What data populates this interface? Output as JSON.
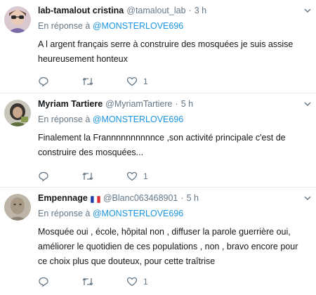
{
  "tweets": [
    {
      "name": "lab-tamalout cristina",
      "flag": false,
      "handle": "@tamalout_lab",
      "separator": "·",
      "time": "3 h",
      "reply_prefix": "En réponse à",
      "reply_mention": "@MONSTERLOVE696",
      "text": "A l argent français serre à construire des mosquées je suis assise heureusement honteux",
      "likes": "1"
    },
    {
      "name": "Myriam Tartiere",
      "flag": false,
      "handle": "@MyriamTartiere",
      "separator": "·",
      "time": "5 h",
      "reply_prefix": "En réponse à",
      "reply_mention": "@MONSTERLOVE696",
      "text": "Finalement la Frannnnnnnnnnce ,son activité principale c'est de construire des mosquées...",
      "likes": "1"
    },
    {
      "name": "Empennage",
      "flag": true,
      "handle": "@Blanc063468901",
      "separator": "·",
      "time": "5 h",
      "reply_prefix": "En réponse à",
      "reply_mention": "@MONSTERLOVE696",
      "text": "Mosquée oui , école, hôpital non , diffuser la parole guerrière oui, améliorer le quotidien de ces populations , non , bravo encore pour ce choix plus que douteux, pour cette traîtrise",
      "likes": "1"
    }
  ],
  "colors": {
    "name": "#14171a",
    "muted": "#657786",
    "mention": "#1b95e0",
    "divider": "#e6ecf0"
  },
  "icons": [
    "reply-icon",
    "retweet-icon",
    "like-icon",
    "chevron-down-icon"
  ]
}
